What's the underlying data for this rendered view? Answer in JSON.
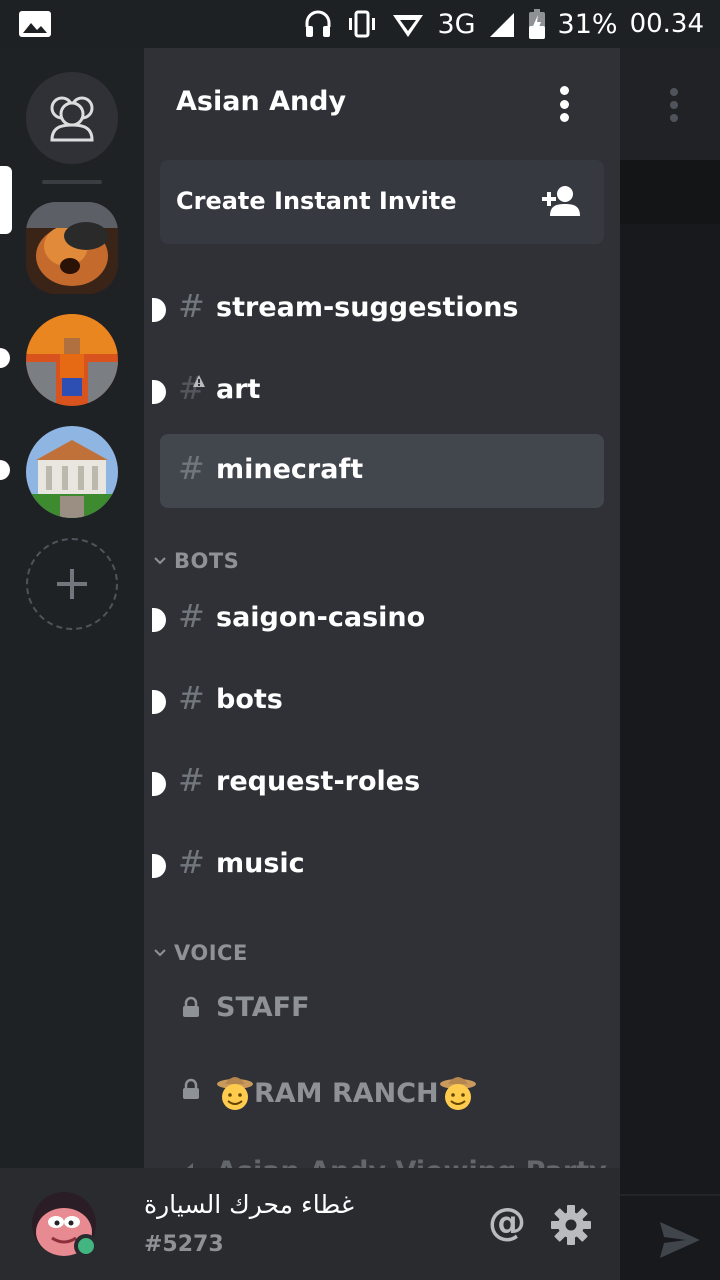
{
  "status_bar": {
    "network": "3G",
    "battery": "31%",
    "time": "00.34",
    "icons": [
      "image-icon",
      "headphones-icon",
      "vibrate-icon",
      "data-arrows-icon",
      "signal-icon",
      "battery-charging-icon"
    ]
  },
  "server_rail": {
    "home_icon": "friends-icon",
    "servers": [
      {
        "name": "server-1",
        "selected": true
      },
      {
        "name": "server-2",
        "unread": true
      },
      {
        "name": "server-3",
        "unread": true
      }
    ],
    "add_icon": "plus-icon"
  },
  "guild": {
    "name": "Asian Andy",
    "menu_icon": "kebab-menu-icon",
    "invite_label": "Create Instant Invite",
    "invite_icon": "add-person-icon"
  },
  "channels": [
    {
      "name": "stream-suggestions",
      "unread": true
    },
    {
      "name": "art",
      "unread": true,
      "locked": true
    },
    {
      "name": "minecraft",
      "selected": true
    }
  ],
  "categories": {
    "bots": {
      "label": "BOTS",
      "channels": [
        {
          "name": "saigon-casino",
          "unread": true
        },
        {
          "name": "bots",
          "unread": true
        },
        {
          "name": "request-roles",
          "unread": true
        },
        {
          "name": "music",
          "unread": true
        }
      ]
    },
    "voice": {
      "label": "VOICE",
      "channels": [
        {
          "name": "STAFF"
        },
        {
          "name": "RAM RANCH",
          "emoji": "cowboy-face"
        },
        {
          "name": "Asian Andy Viewing Party"
        }
      ]
    }
  },
  "user": {
    "name": "غطاء محرك السيارة",
    "tag": "#5273",
    "status": "online",
    "status_color": "#43b581",
    "mention_label": "@",
    "settings_icon": "gear-icon"
  },
  "colors": {
    "rail_bg": "#1f2225",
    "panel_bg": "#2f3136",
    "selected_bg": "#42464d",
    "muted_text": "#8e9297",
    "online": "#43b581"
  }
}
